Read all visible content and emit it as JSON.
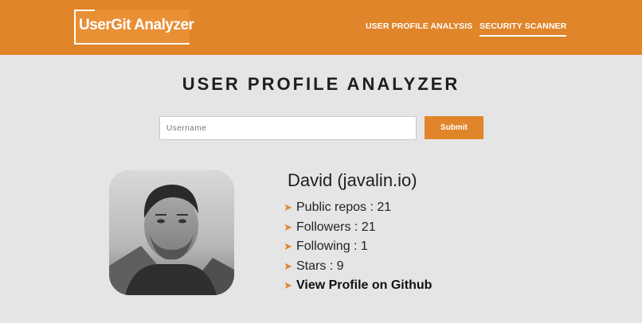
{
  "header": {
    "logo_text": "UserGit Analyzer",
    "nav": [
      {
        "label": "USER PROFILE ANALYSIS",
        "active": false
      },
      {
        "label": "SECURITY SCANNER",
        "active": true
      }
    ],
    "accent_color": "#e0852a"
  },
  "main": {
    "title": "USER PROFILE ANALYZER",
    "search": {
      "placeholder": "Username",
      "value": ""
    },
    "submit_label": "Submit"
  },
  "profile": {
    "avatar_icon": "user-avatar-photo",
    "name": "David (javalin.io)",
    "stats": [
      {
        "label": "Public repos : 21"
      },
      {
        "label": "Followers : 21"
      },
      {
        "label": "Following : 1"
      },
      {
        "label": "Stars : 9"
      }
    ],
    "link_label": "View Profile on Github",
    "bullet_icon": "arrow-right-icon"
  }
}
